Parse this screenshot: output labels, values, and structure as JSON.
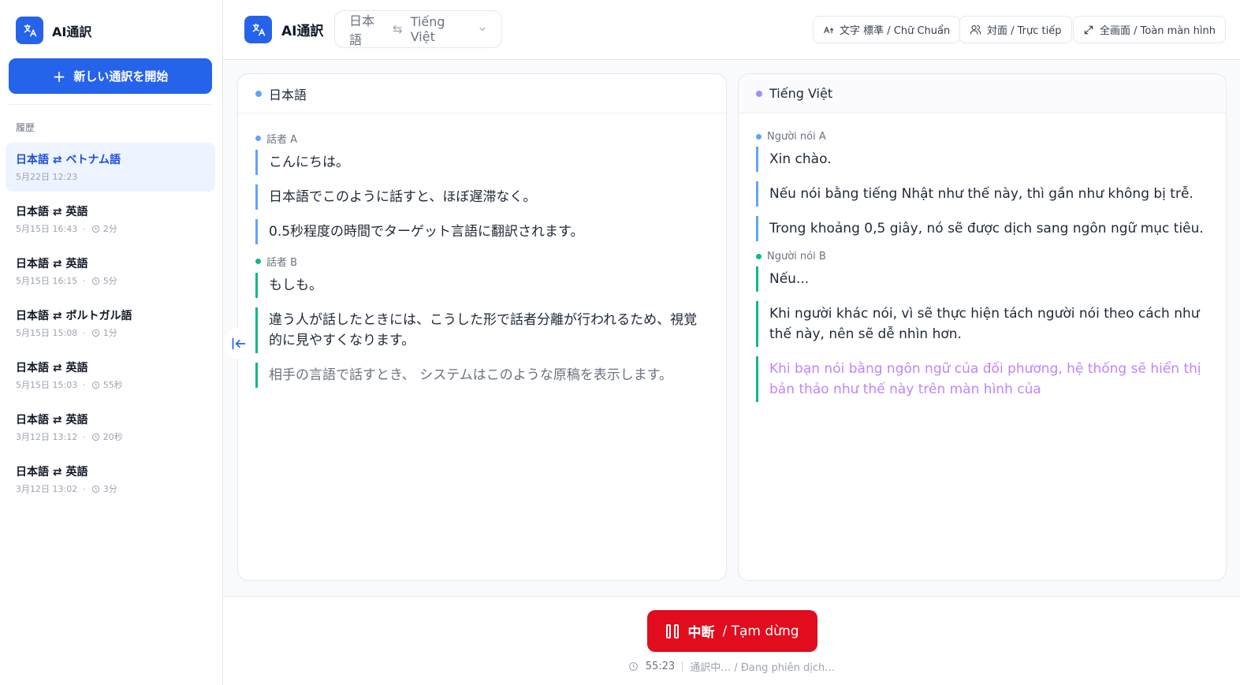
{
  "app": {
    "name": "AI通訳",
    "brand_color": "#2563eb"
  },
  "sidebar": {
    "new_button_label": "新しい通訳を開始",
    "history_title": "履歴",
    "history": [
      {
        "title": "日本語 ⇄ ベトナム語",
        "date": "5月22日 12:23",
        "duration": "",
        "active": true
      },
      {
        "title": "日本語 ⇄ 英語",
        "date": "5月15日 16:43",
        "duration": "2分",
        "active": false
      },
      {
        "title": "日本語 ⇄ 英語",
        "date": "5月15日 16:15",
        "duration": "5分",
        "active": false
      },
      {
        "title": "日本語 ⇄ ポルトガル語",
        "date": "5月15日 15:08",
        "duration": "1分",
        "active": false
      },
      {
        "title": "日本語 ⇄ 英語",
        "date": "5月15日 15:03",
        "duration": "55秒",
        "active": false
      },
      {
        "title": "日本語 ⇄ 英語",
        "date": "3月12日 13:12",
        "duration": "20秒",
        "active": false
      },
      {
        "title": "日本語 ⇄ 英語",
        "date": "3月12日 13:02",
        "duration": "3分",
        "active": false
      }
    ]
  },
  "header": {
    "source_lang": "日本語",
    "target_lang": "Tiếng Việt",
    "text_size_label": "文字 標準 / Chữ Chuẩn",
    "face_to_face_label": "対面 / Trực tiếp",
    "fullscreen_label": "全画面 / Toàn màn hình"
  },
  "panels": {
    "left": {
      "title": "日本語",
      "dot_color": "#60a5fa",
      "groups": [
        {
          "speaker": "話者 A",
          "color": "#60a5fa",
          "lines": [
            "こんにちは。",
            "日本語でこのように話すと、ほぼ遅滞なく。",
            "0.5秒程度の時間でターゲット言語に翻訳されます。"
          ],
          "draft": ""
        },
        {
          "speaker": "話者 B",
          "color": "#10b981",
          "lines": [
            "もしも。",
            "違う人が話したときには、こうした形で話者分離が行われるため、視覚的に見やすくなります。"
          ],
          "draft": "相手の言語で話すとき、 システムはこのような原稿を表示します。"
        }
      ]
    },
    "right": {
      "title": "Tiếng Việt",
      "dot_color": "#a78bfa",
      "groups": [
        {
          "speaker": "Người nói A",
          "color": "#60a5fa",
          "lines": [
            "Xin chào.",
            "Nếu nói bằng tiếng Nhật như thế này, thì gần như không bị trễ.",
            "Trong khoảng 0,5 giây, nó sẽ được dịch sang ngôn ngữ mục tiêu."
          ],
          "draft": ""
        },
        {
          "speaker": "Người nói B",
          "color": "#10b981",
          "lines": [
            "Nếu...",
            "Khi người khác nói, vì sẽ thực hiện tách người nói theo cách như thế này, nên sẽ dễ nhìn hơn."
          ],
          "draft": "Khi bạn nói bằng ngôn ngữ của đối phương, hệ thống sẽ hiển thị bản thảo như thế này trên màn hình của"
        }
      ]
    }
  },
  "footer": {
    "pause_label_ja": "中断",
    "pause_label_vi": "/ Tạm dừng",
    "pause_color": "#e10c1e",
    "elapsed": "55:23",
    "status": "通訳中… / Đang phiên dịch…"
  }
}
